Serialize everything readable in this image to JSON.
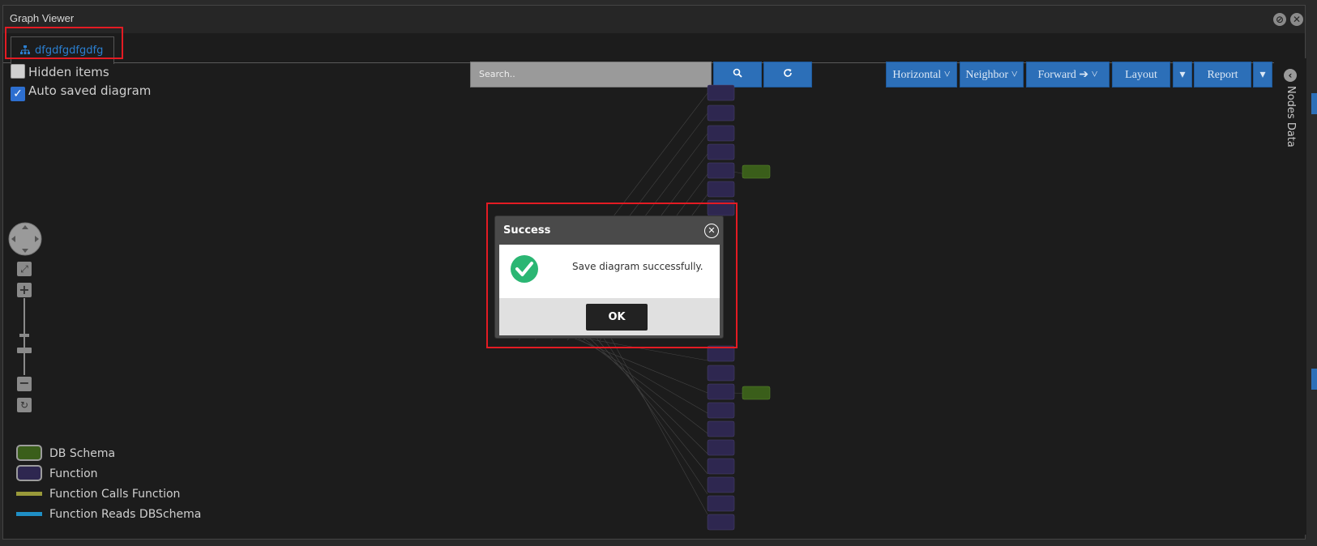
{
  "window": {
    "title": "Graph Viewer"
  },
  "tab": {
    "label": "dfgdfgdfgdfg"
  },
  "options": {
    "hidden_items": "Hidden items",
    "auto_saved": "Auto saved diagram"
  },
  "search": {
    "placeholder": "Search.."
  },
  "toolbar": {
    "horizontal": "Horizontal",
    "neighbor": "Neighbor",
    "forward": "Forward",
    "layout": "Layout",
    "report": "Report"
  },
  "side_panel": {
    "label": "Nodes Data"
  },
  "legend": [
    {
      "label": "DB Schema",
      "color": "#3a5e1a"
    },
    {
      "label": "Function",
      "color": "#2e2750"
    },
    {
      "label": "Function Calls Function",
      "color": "#9a9a3a"
    },
    {
      "label": "Function Reads DBSchema",
      "color": "#1f8fc6"
    }
  ],
  "dialog": {
    "title": "Success",
    "message": "Save diagram successfully.",
    "ok": "OK"
  },
  "colors": {
    "accent": "#2c6fb8",
    "highlight": "#e31b23",
    "success": "#2bb673"
  }
}
